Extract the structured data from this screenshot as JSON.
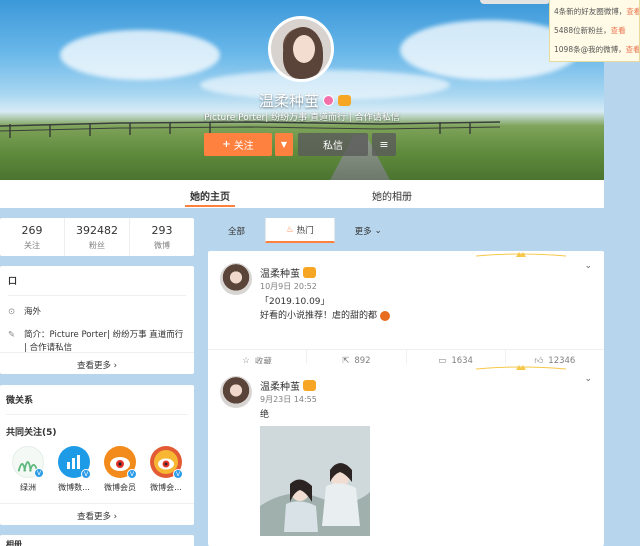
{
  "profile": {
    "nickname": "温柔种茧",
    "bio": "Picture Porter| 纷纷万事 直道而行 | 合作请私信",
    "follow_label": "关注",
    "message_label": "私信"
  },
  "tabs": [
    {
      "label": "她的主页",
      "active": true
    },
    {
      "label": "她的相册",
      "active": false
    }
  ],
  "notifications": [
    {
      "text": "4条新的好友圈微博，",
      "link": "查看"
    },
    {
      "text": "5488位新粉丝，",
      "link": "查看"
    },
    {
      "text": "1098条@我的微博，",
      "link": "查看"
    }
  ],
  "stats": [
    {
      "value": "269",
      "label": "关注"
    },
    {
      "value": "392482",
      "label": "粉丝"
    },
    {
      "value": "293",
      "label": "微博"
    }
  ],
  "info": {
    "title": "口",
    "location": "海外",
    "intro_label": "简介：",
    "intro": "Picture Porter| 纷纷万事 直道而行 | 合作请私信",
    "more": "查看更多"
  },
  "relations": {
    "title": "微关系",
    "common_follow": "共同关注(5)",
    "items": [
      {
        "name": "绿洲",
        "color": "#ffffff"
      },
      {
        "name": "微博数...",
        "color": "#1e9be7"
      },
      {
        "name": "微博会员",
        "color": "#f28b1c"
      },
      {
        "name": "微博会...",
        "color": "#e35b35"
      }
    ],
    "more": "查看更多"
  },
  "bottom_card_title": "相册",
  "filter_tabs": [
    {
      "label": "全部",
      "active": false
    },
    {
      "label": "热门",
      "active": true
    },
    {
      "label": "更多",
      "active": false
    }
  ],
  "posts": [
    {
      "name": "温柔种茧",
      "time": "10月9日 20:52",
      "line1": "「2019.10.09」",
      "line2": "好看的小说推荐！虐的甜的都",
      "actions": [
        {
          "icon": "star-icon",
          "label": "收藏"
        },
        {
          "icon": "share-icon",
          "label": "892"
        },
        {
          "icon": "comment-icon",
          "label": "1634"
        },
        {
          "icon": "like-icon",
          "label": "12346"
        }
      ]
    },
    {
      "name": "温柔种茧",
      "time": "9月23日 14:55",
      "line1": "绝"
    }
  ]
}
